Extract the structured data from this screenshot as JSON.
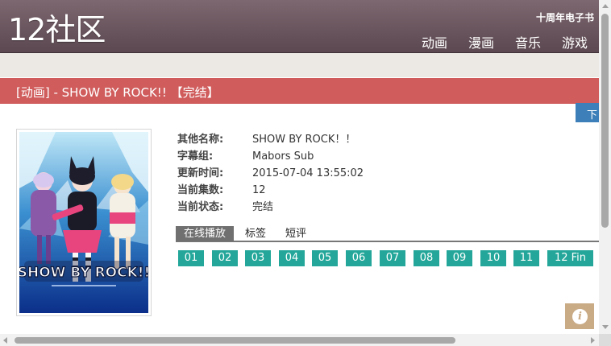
{
  "header": {
    "logo": "12社区",
    "ebook_link": "十周年电子书",
    "nav": [
      {
        "label": "动画"
      },
      {
        "label": "漫画"
      },
      {
        "label": "音乐"
      },
      {
        "label": "游戏"
      }
    ]
  },
  "title_bar": {
    "title": "[动画] - SHOW BY ROCK!! 【完结】"
  },
  "download_tab": "下",
  "cover": {
    "logo_text": "SHOW BY ROCK!!"
  },
  "info": [
    {
      "label": "其他名称:",
      "value": "SHOW BY ROCK！！"
    },
    {
      "label": "字幕组:",
      "value": "Mabors Sub"
    },
    {
      "label": "更新时间:",
      "value": "2015-07-04 13:55:02"
    },
    {
      "label": "当前集数:",
      "value": "12"
    },
    {
      "label": "当前状态:",
      "value": "完结"
    }
  ],
  "tabs": [
    {
      "label": "在线播放",
      "active": true
    },
    {
      "label": "标签",
      "active": false
    },
    {
      "label": "短评",
      "active": false
    }
  ],
  "episodes": [
    "01",
    "02",
    "03",
    "04",
    "05",
    "06",
    "07",
    "08",
    "09",
    "10",
    "11",
    "12 Fin"
  ],
  "info_button_glyph": "i",
  "colors": {
    "header": "#6a565e",
    "title_bar": "#d05c5c",
    "episode": "#24a79a",
    "download_tab": "#3d7fb8",
    "info_button": "#c9ab86"
  }
}
